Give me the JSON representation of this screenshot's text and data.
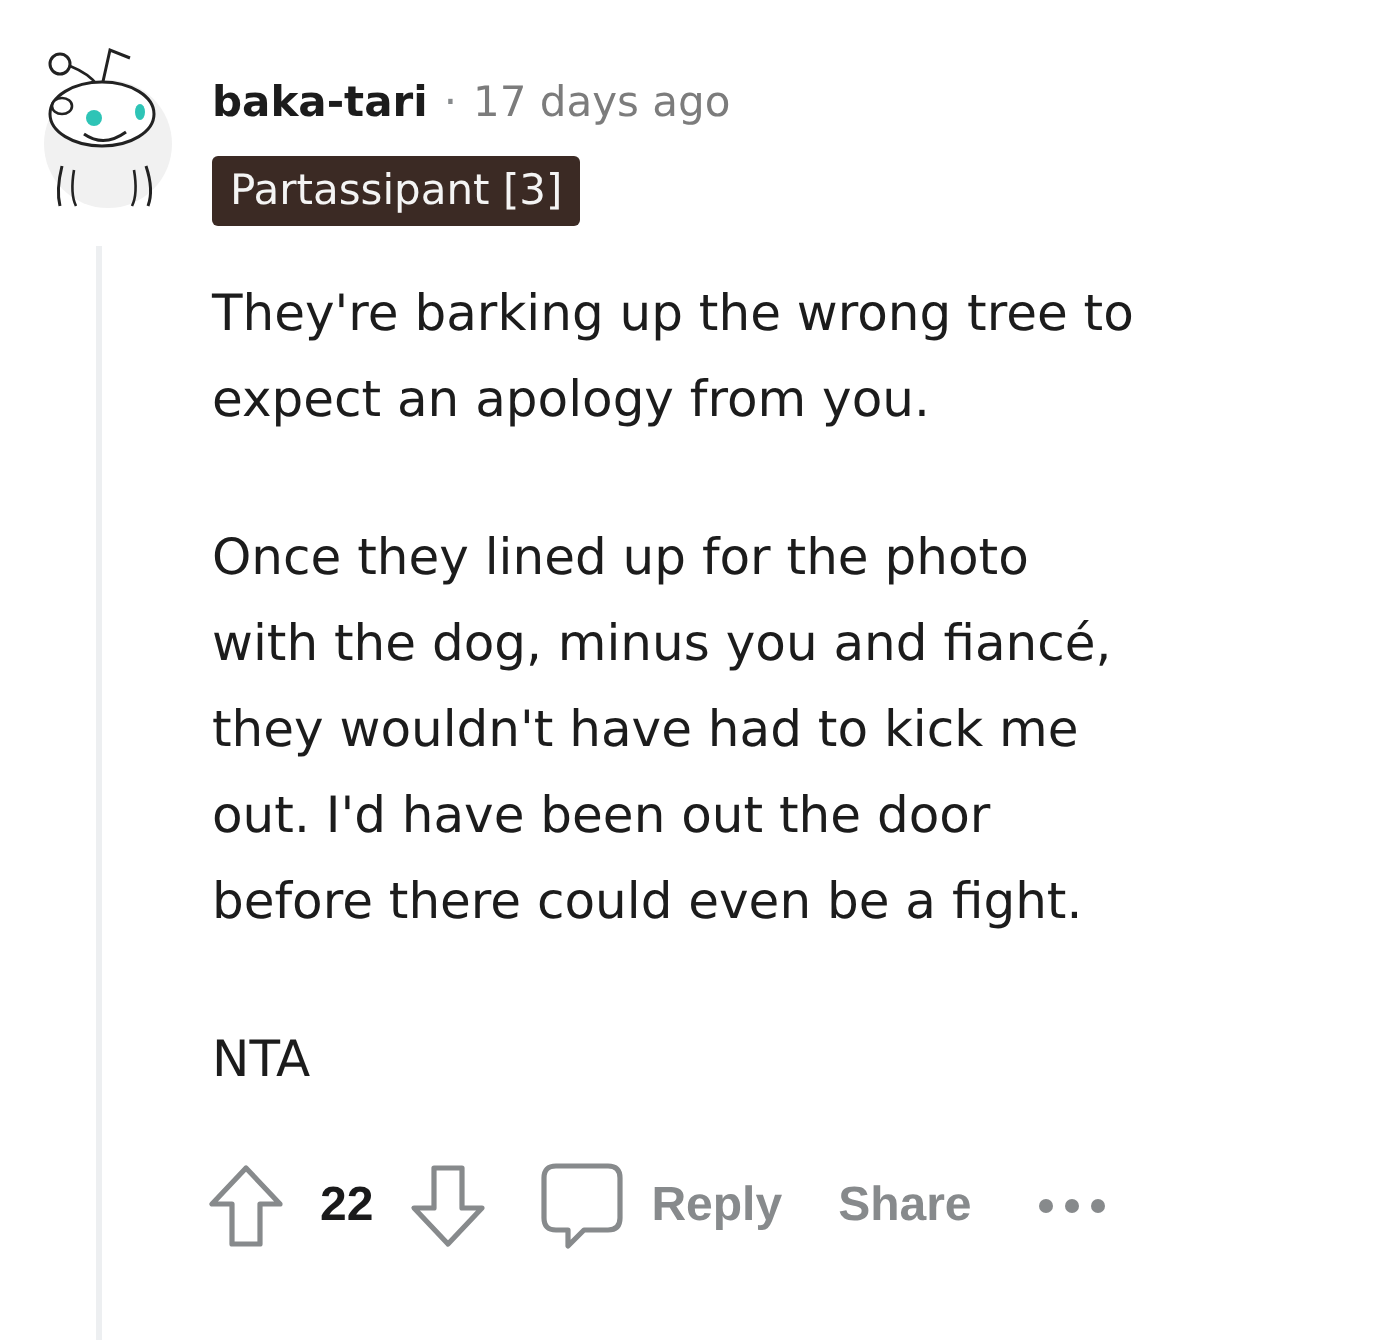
{
  "comment": {
    "author": "baka-tari",
    "separator": "·",
    "time": "17 days ago",
    "flair": "Partassipant [3]",
    "paragraphs": [
      {
        "lines": [
          "They're barking up the wrong tree to",
          "expect an apology from you."
        ]
      },
      {
        "lines": [
          "Once they lined up for the photo",
          "with the dog, minus you and fiancé,",
          "they wouldn't have had to kick me",
          "out. I'd have been out the door",
          "before there could even be a fight."
        ]
      },
      {
        "lines": [
          "NTA"
        ]
      }
    ],
    "score": "22",
    "actions": [
      {
        "kind": "reply",
        "label": "Reply"
      },
      {
        "kind": "share",
        "label": "Share"
      }
    ]
  }
}
